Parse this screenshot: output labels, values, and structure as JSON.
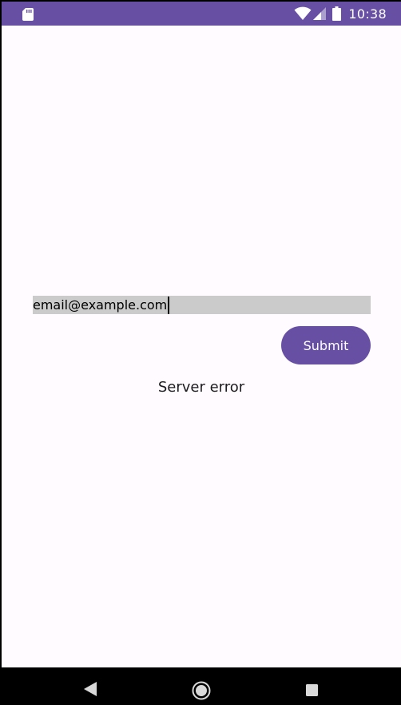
{
  "status_bar": {
    "time": "10:38",
    "background_color": "#6750a4",
    "icons": [
      "sd-card-icon",
      "wifi-icon",
      "signal-icon",
      "battery-icon"
    ]
  },
  "form": {
    "email_value": "email@example.com",
    "submit_label": "Submit",
    "error_message": "Server error"
  },
  "nav_bar": {
    "icons": [
      "back-icon",
      "home-icon",
      "recent-apps-icon"
    ]
  },
  "colors": {
    "accent": "#6750a4",
    "field_background": "#cbcbcb",
    "page_background": "#fffbfe"
  }
}
